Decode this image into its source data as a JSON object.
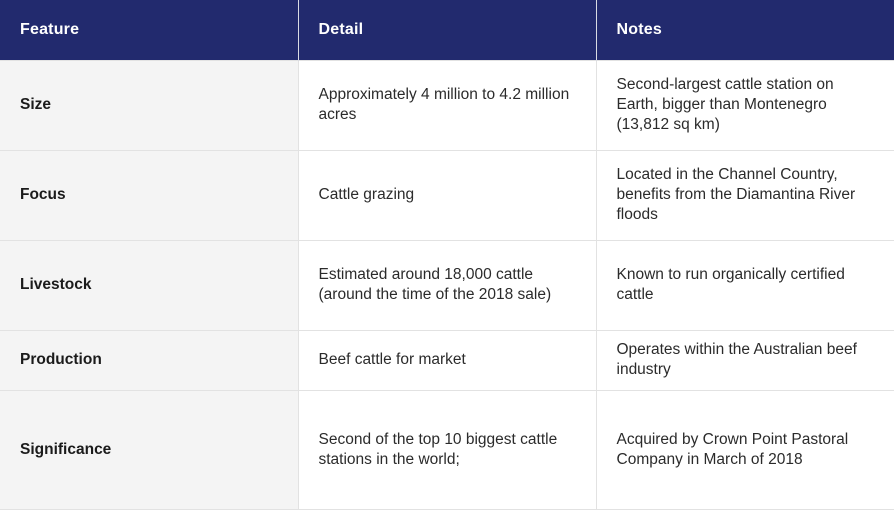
{
  "table": {
    "headers": [
      "Feature",
      "Detail",
      "Notes"
    ],
    "rows": [
      {
        "feature": "Size",
        "detail": "Approximately 4 million to 4.2 million acres",
        "notes": "Second-largest cattle station on Earth, bigger than Montenegro (13,812 sq km)"
      },
      {
        "feature": "Focus",
        "detail": "Cattle grazing",
        "notes": "Located in the Channel Country, benefits from the Diamantina River floods"
      },
      {
        "feature": "Livestock",
        "detail": "Estimated around 18,000 cattle (around the time of the 2018 sale)",
        "notes": "Known to run organically certified cattle"
      },
      {
        "feature": "Production",
        "detail": "Beef cattle for market",
        "notes": "Operates within the Australian beef industry"
      },
      {
        "feature": "Significance",
        "detail": "Second of the top 10 biggest cattle stations in the world;",
        "notes": "Acquired by Crown Point Pastoral Company in March of 2018"
      }
    ]
  },
  "colors": {
    "header_background": "#222a6e",
    "header_text": "#ffffff",
    "feature_column_background": "#f4f4f4",
    "border": "#e2e2e2"
  }
}
